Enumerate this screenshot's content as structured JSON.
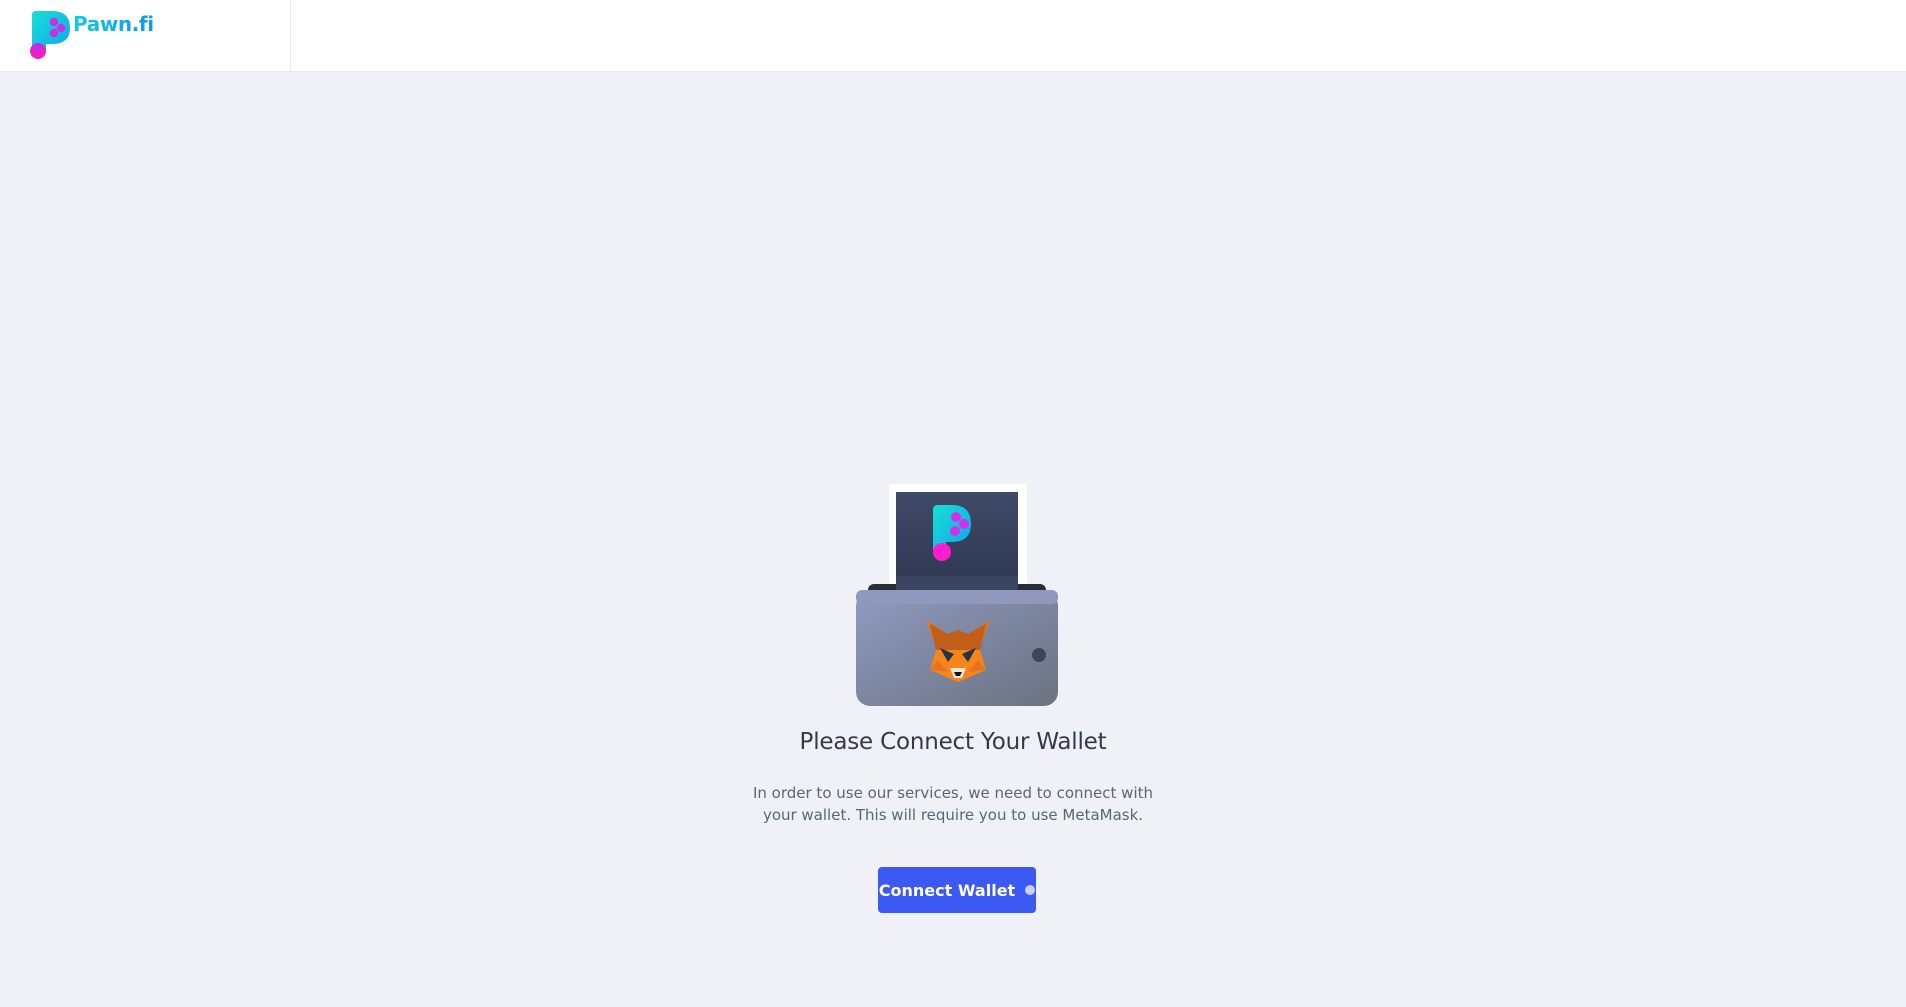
{
  "header": {
    "brand_name": "Pawn.fi",
    "logo_icon": "pawnfi-logo-icon"
  },
  "main": {
    "illustration_icon": "wallet-metamask-illustration",
    "title": "Please Connect Your Wallet",
    "description": "In order to use our services, we need to connect with your wallet. This will require you to use MetaMask.",
    "connect_button_label": "Connect Wallet",
    "button_status_icon": "loading-dot-icon"
  },
  "colors": {
    "background": "#eff1f6",
    "brand_cyan": "#10b7e9",
    "brand_magenta": "#e11bd6",
    "button_primary": "#3c5af3",
    "title_text": "#2f3a4b",
    "body_text": "#5b6577"
  }
}
